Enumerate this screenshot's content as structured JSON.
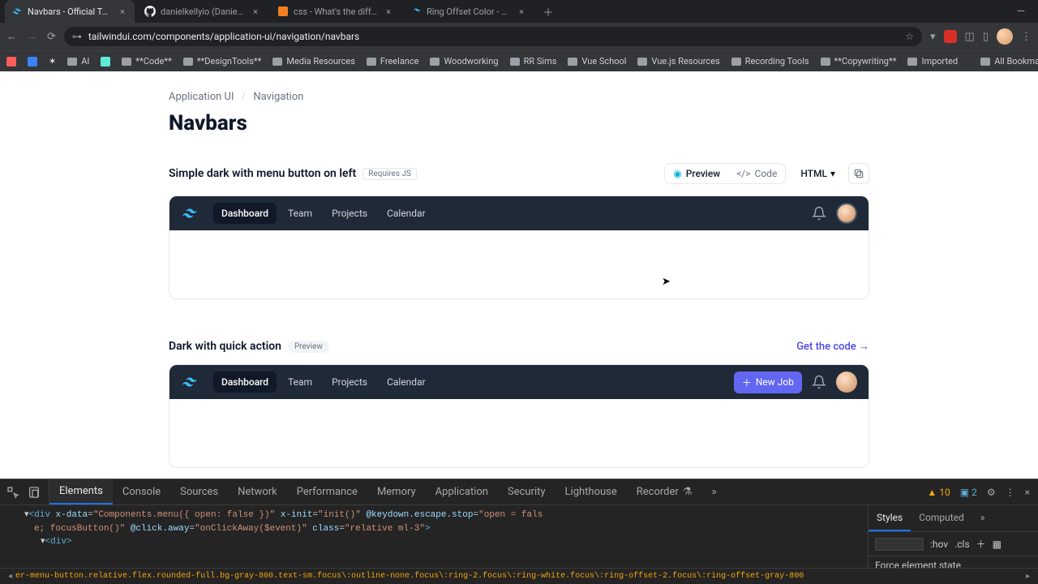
{
  "tabs": [
    {
      "title": "Navbars - Official Tailwind C",
      "favicon_color": "#38bdf8"
    },
    {
      "title": "danielkellyio (Daniel Kelly)",
      "favicon_color": "#ffffff"
    },
    {
      "title": "css - What's the difference b",
      "favicon_color": "#f48024"
    },
    {
      "title": "Ring Offset Color - Tailwind C",
      "favicon_color": "#38bdf8"
    }
  ],
  "address": "tailwindui.com/components/application-ui/navigation/navbars",
  "bookmarks": [
    "AI",
    "**Code**",
    "**DesignTools**",
    "Media Resources",
    "Freelance",
    "Woodworking",
    "RR Sims",
    "Vue School",
    "Vue.js Resources",
    "Recording Tools",
    "**Copywriting**",
    "Imported"
  ],
  "all_bookmarks": "All Bookmarks",
  "breadcrumb": {
    "parent": "Application UI",
    "current": "Navigation",
    "sep": "/"
  },
  "page_title": "Navbars",
  "section1": {
    "title": "Simple dark with menu button on left",
    "badge": "Requires JS",
    "toolbar": {
      "preview": "Preview",
      "code": "Code",
      "lang": "HTML"
    },
    "nav_items": [
      "Dashboard",
      "Team",
      "Projects",
      "Calendar"
    ]
  },
  "section2": {
    "title": "Dark with quick action",
    "badge": "Preview",
    "getcode": "Get the code →",
    "nav_items": [
      "Dashboard",
      "Team",
      "Projects",
      "Calendar"
    ],
    "action": "New Job"
  },
  "devtools": {
    "tabs": [
      "Elements",
      "Console",
      "Sources",
      "Network",
      "Performance",
      "Memory",
      "Application",
      "Security",
      "Lighthouse",
      "Recorder"
    ],
    "warnings": "10",
    "info": "2",
    "styles_tabs": [
      "Styles",
      "Computed"
    ],
    "hov": ":hov",
    "cls": ".cls",
    "force_state": "Force element state",
    "dom_line1_pre": "<div ",
    "dom_line1_attrs": "x-data=\"Components.menu({ open: false })\" x-init=\"init()\" @keydown.escape.stop=\"open = false; focusButton()\" @click.away=\"onClickAway($event)\" class=\"relative ml-3\">",
    "dom_line2": "<div>",
    "crumbs": "er-menu-button.relative.flex.rounded-full.bg-gray-800.text-sm.focus\\:outline-none.focus\\:ring-2.focus\\:ring-white.focus\\:ring-offset-2.focus\\:ring-offset-gray-800"
  }
}
